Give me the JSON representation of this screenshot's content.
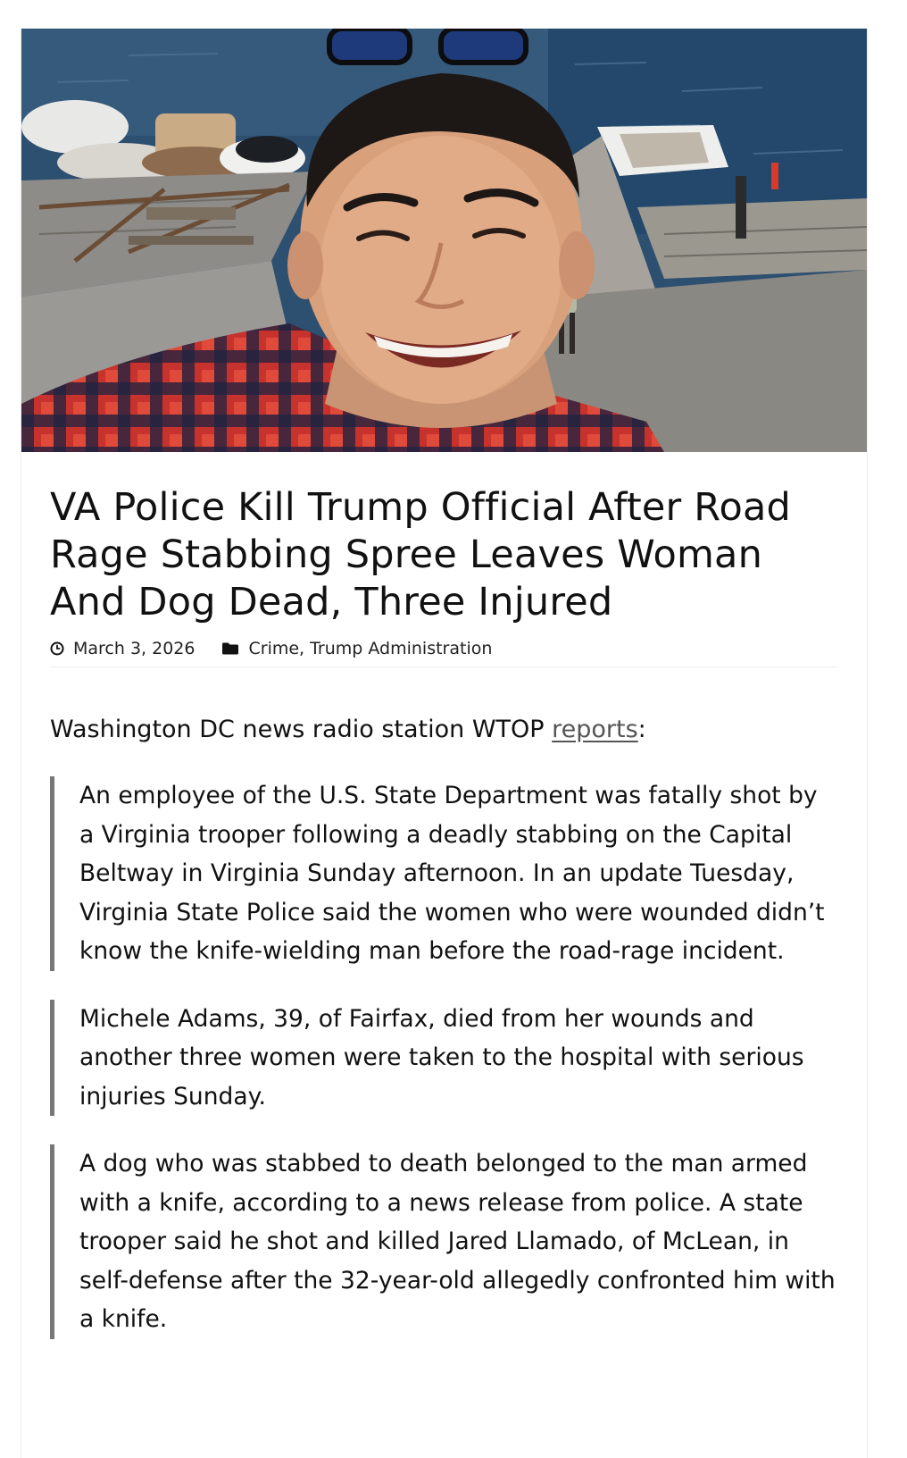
{
  "article": {
    "image_alt": "Smiling man in plaid shirt at a marina",
    "title": "VA Police Kill Trump Official After Road Rage Stabbing Spree Leaves Woman And Dog Dead, Three Injured",
    "date": "March 3, 2026",
    "category_1": "Crime",
    "category_separator": ",",
    "category_2": "Trump Administration",
    "intro_text": "Washington DC news radio station WTOP ",
    "intro_link": "reports",
    "intro_suffix": ":",
    "quotes": [
      "An employee of the U.S. State Department was fatally shot by a Virginia trooper following a deadly stabbing on the Capital Beltway in Virginia Sunday afternoon. In an update Tuesday, Virginia State Police said the women who were wounded didn’t know the knife-wielding man before the road-rage incident.",
      "Michele Adams, 39, of Fairfax, died from her wounds and another three women were taken to the hospital with serious injuries Sunday.",
      "A dog who was stabbed to death belonged to the man armed with a knife, according to a news release from police. A state trooper said he shot and killed Jared Llamado, of McLean, in self-defense after the 32-year-old allegedly confronted him with a knife."
    ]
  },
  "icons": {
    "date": "clock-icon",
    "category": "folder-icon"
  }
}
